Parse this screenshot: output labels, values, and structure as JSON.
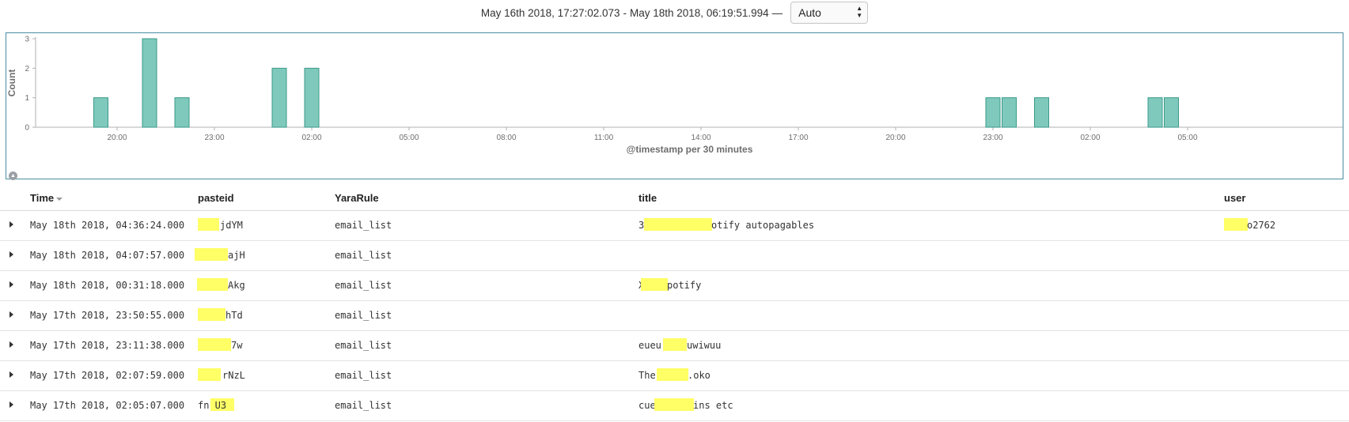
{
  "range": {
    "from": "May 16th 2018, 17:27:02.073",
    "separator": "-",
    "to": "May 18th 2018, 06:19:51.994",
    "dash": "—",
    "interval": "Auto"
  },
  "chart_data": {
    "type": "bar",
    "title": "",
    "xlabel": "@timestamp per 30 minutes",
    "ylabel": "Count",
    "ylim": [
      0,
      3
    ],
    "yticks": [
      "0",
      "1",
      "2",
      "3"
    ],
    "xticks": [
      "20:00",
      "23:00",
      "02:00",
      "05:00",
      "08:00",
      "11:00",
      "14:00",
      "17:00",
      "20:00",
      "23:00",
      "02:00",
      "05:00"
    ],
    "x_unit": "half-hour buckets from 2018-05-16 17:30",
    "bars": [
      {
        "bucket": "May 16 19:30",
        "count": 1
      },
      {
        "bucket": "May 16 21:00",
        "count": 3
      },
      {
        "bucket": "May 16 22:00",
        "count": 1
      },
      {
        "bucket": "May 17 01:00",
        "count": 2
      },
      {
        "bucket": "May 17 02:00",
        "count": 2
      },
      {
        "bucket": "May 17 23:00",
        "count": 1
      },
      {
        "bucket": "May 17 23:30",
        "count": 1
      },
      {
        "bucket": "May 18 00:30",
        "count": 1
      },
      {
        "bucket": "May 18 04:00",
        "count": 1
      },
      {
        "bucket": "May 18 04:30",
        "count": 1
      }
    ],
    "bar_color": "#7fc9bc",
    "bar_stroke": "#3a9a8a"
  },
  "table": {
    "headers": {
      "time": "Time",
      "pasteid": "pasteid",
      "yararule": "YaraRule",
      "title": "title",
      "user": "user"
    },
    "rows": [
      {
        "time": "May 18th 2018, 04:36:24.000",
        "pasteid": "jdYM",
        "yararule": "email_list",
        "title_a": "3",
        "title_b": "otify autopagables",
        "user": "o2762"
      },
      {
        "time": "May 18th 2018, 04:07:57.000",
        "pasteid": "ajH",
        "yararule": "email_list",
        "title_a": "",
        "title_b": "",
        "user": ""
      },
      {
        "time": "May 18th 2018, 00:31:18.000",
        "pasteid": "Akg",
        "yararule": "email_list",
        "title_a": "X",
        "title_b": "potify",
        "user": ""
      },
      {
        "time": "May 17th 2018, 23:50:55.000",
        "pasteid": "hTd",
        "yararule": "email_list",
        "title_a": "",
        "title_b": "",
        "user": ""
      },
      {
        "time": "May 17th 2018, 23:11:38.000",
        "pasteid": "7w",
        "yararule": "email_list",
        "title_a": "eueu",
        "title_b": "uwiwuu",
        "user": ""
      },
      {
        "time": "May 17th 2018, 02:07:59.000",
        "pasteid": "rNzL",
        "yararule": "email_list",
        "title_a": "The",
        "title_b": ".oko",
        "user": ""
      },
      {
        "time": "May 17th 2018, 02:05:07.000",
        "pasteid": "fn U3",
        "yararule": "email_list",
        "title_a": "cue",
        "title_b": "ins etc",
        "user": ""
      }
    ]
  },
  "colors": {
    "redaction": "#ffff66",
    "panel_border": "#4a8ea3",
    "axis": "#8a8a8a"
  }
}
